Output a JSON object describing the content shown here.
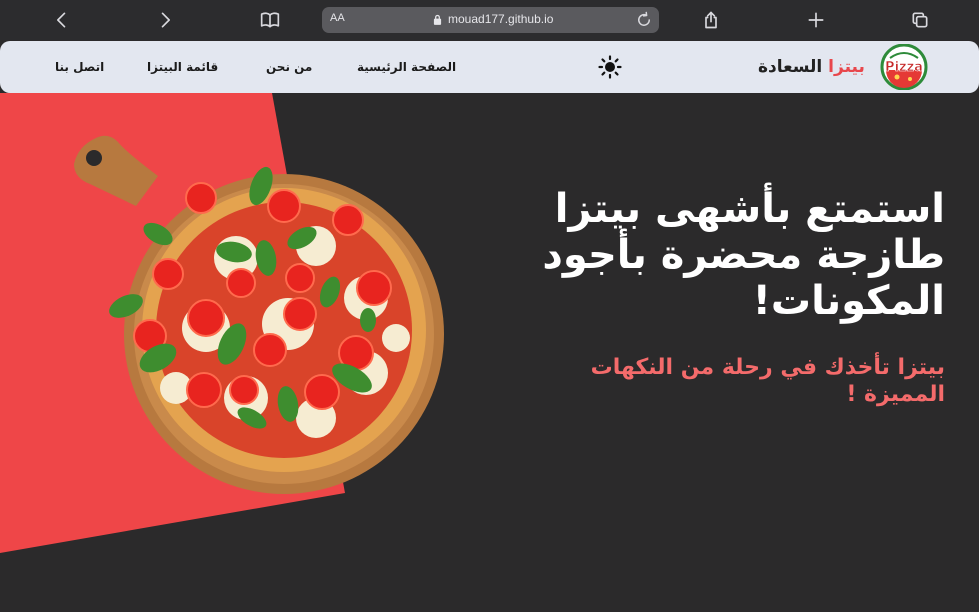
{
  "browser": {
    "aa_label": "AA",
    "url": "mouad177.github.io"
  },
  "header": {
    "brand_accent": "بيتزا",
    "brand_name": "السعادة",
    "logo_text": "Pizza",
    "nav": {
      "home": "الصفحة الرئيسية",
      "about": "من نحن",
      "menu": "قائمة البيتزا",
      "contact": "اتصل بنا"
    }
  },
  "hero": {
    "headline": "استمتع بأشهى بيتزا طازجة محضرة بأجود المكونات!",
    "subline": "بيتزا تأخذك في رحلة من النكهات المميزة !"
  },
  "colors": {
    "background": "#2b2a2b",
    "accent_red": "#ef4648",
    "subline_pink": "#f46b6b",
    "header_bg": "#e3e7f0"
  },
  "icons": [
    "back-icon",
    "forward-icon",
    "book-icon",
    "lock-icon",
    "reload-icon",
    "share-icon",
    "plus-icon",
    "tabs-icon",
    "sun-icon",
    "pizza-logo"
  ]
}
